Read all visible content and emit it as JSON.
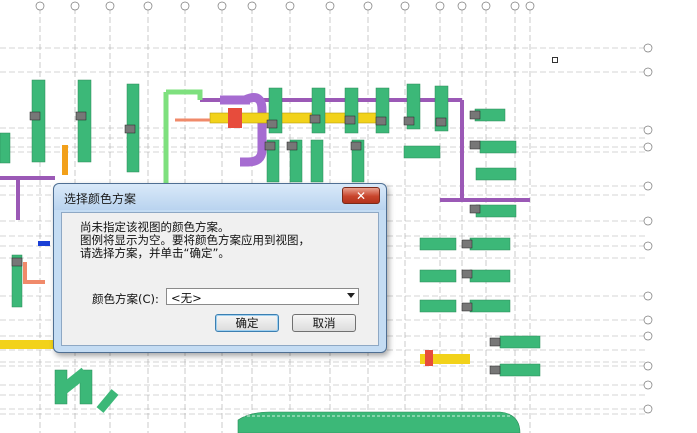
{
  "dialog": {
    "title": "选择颜色方案",
    "close_label": "✕",
    "message_lines": [
      "尚未指定该视图的颜色方案。",
      "图例将显示为空。要将颜色方案应用到视图，",
      "请选择方案，并单击“确定”。"
    ],
    "scheme_label": "颜色方案(C):",
    "scheme_value": "<无>",
    "ok_label": "确定",
    "cancel_label": "取消"
  },
  "colors": {
    "duct_green": "#3cb878",
    "pipe_purple": "#9b59b6",
    "duct_yellow": "#f2d21a",
    "grid_gray": "#9a9a9a",
    "dialog_frame": "#c4dcf3",
    "close_red": "#c8452c"
  }
}
